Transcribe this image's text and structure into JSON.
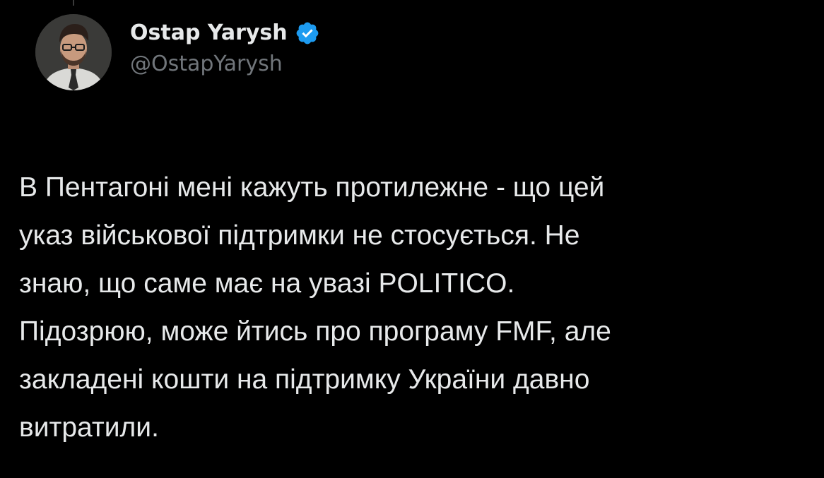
{
  "author": {
    "display_name": "Ostap Yarysh",
    "handle": "@OstapYarysh",
    "verified_icon": "verified-badge-icon",
    "avatar_icon": "avatar-portrait"
  },
  "tweet": {
    "lines": [
      "В Пентагоні мені кажуть протилежне - що цей",
      "указ військової підтримки не стосується. Не",
      "знаю, що саме має на увазі POLITICO.",
      "Підозрюю, може йтись про програму FMF, але",
      "закладені кошти на підтримку України давно",
      "витратили."
    ]
  },
  "colors": {
    "background": "#000000",
    "text_primary": "#e7e9ea",
    "text_secondary": "#71767b",
    "verified_blue": "#1d9bf0"
  }
}
